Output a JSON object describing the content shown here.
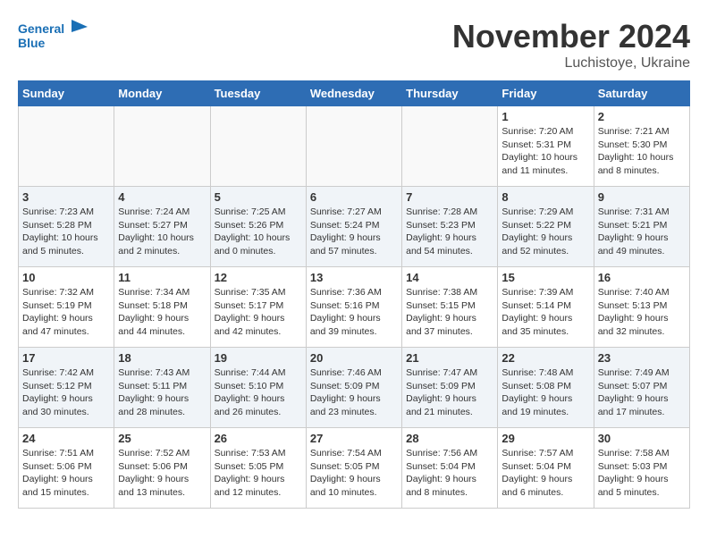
{
  "header": {
    "logo": {
      "line1": "General",
      "line2": "Blue"
    },
    "month": "November 2024",
    "location": "Luchistoye, Ukraine"
  },
  "weekdays": [
    "Sunday",
    "Monday",
    "Tuesday",
    "Wednesday",
    "Thursday",
    "Friday",
    "Saturday"
  ],
  "weeks": [
    [
      {
        "day": "",
        "info": ""
      },
      {
        "day": "",
        "info": ""
      },
      {
        "day": "",
        "info": ""
      },
      {
        "day": "",
        "info": ""
      },
      {
        "day": "",
        "info": ""
      },
      {
        "day": "1",
        "info": "Sunrise: 7:20 AM\nSunset: 5:31 PM\nDaylight: 10 hours and 11 minutes."
      },
      {
        "day": "2",
        "info": "Sunrise: 7:21 AM\nSunset: 5:30 PM\nDaylight: 10 hours and 8 minutes."
      }
    ],
    [
      {
        "day": "3",
        "info": "Sunrise: 7:23 AM\nSunset: 5:28 PM\nDaylight: 10 hours and 5 minutes."
      },
      {
        "day": "4",
        "info": "Sunrise: 7:24 AM\nSunset: 5:27 PM\nDaylight: 10 hours and 2 minutes."
      },
      {
        "day": "5",
        "info": "Sunrise: 7:25 AM\nSunset: 5:26 PM\nDaylight: 10 hours and 0 minutes."
      },
      {
        "day": "6",
        "info": "Sunrise: 7:27 AM\nSunset: 5:24 PM\nDaylight: 9 hours and 57 minutes."
      },
      {
        "day": "7",
        "info": "Sunrise: 7:28 AM\nSunset: 5:23 PM\nDaylight: 9 hours and 54 minutes."
      },
      {
        "day": "8",
        "info": "Sunrise: 7:29 AM\nSunset: 5:22 PM\nDaylight: 9 hours and 52 minutes."
      },
      {
        "day": "9",
        "info": "Sunrise: 7:31 AM\nSunset: 5:21 PM\nDaylight: 9 hours and 49 minutes."
      }
    ],
    [
      {
        "day": "10",
        "info": "Sunrise: 7:32 AM\nSunset: 5:19 PM\nDaylight: 9 hours and 47 minutes."
      },
      {
        "day": "11",
        "info": "Sunrise: 7:34 AM\nSunset: 5:18 PM\nDaylight: 9 hours and 44 minutes."
      },
      {
        "day": "12",
        "info": "Sunrise: 7:35 AM\nSunset: 5:17 PM\nDaylight: 9 hours and 42 minutes."
      },
      {
        "day": "13",
        "info": "Sunrise: 7:36 AM\nSunset: 5:16 PM\nDaylight: 9 hours and 39 minutes."
      },
      {
        "day": "14",
        "info": "Sunrise: 7:38 AM\nSunset: 5:15 PM\nDaylight: 9 hours and 37 minutes."
      },
      {
        "day": "15",
        "info": "Sunrise: 7:39 AM\nSunset: 5:14 PM\nDaylight: 9 hours and 35 minutes."
      },
      {
        "day": "16",
        "info": "Sunrise: 7:40 AM\nSunset: 5:13 PM\nDaylight: 9 hours and 32 minutes."
      }
    ],
    [
      {
        "day": "17",
        "info": "Sunrise: 7:42 AM\nSunset: 5:12 PM\nDaylight: 9 hours and 30 minutes."
      },
      {
        "day": "18",
        "info": "Sunrise: 7:43 AM\nSunset: 5:11 PM\nDaylight: 9 hours and 28 minutes."
      },
      {
        "day": "19",
        "info": "Sunrise: 7:44 AM\nSunset: 5:10 PM\nDaylight: 9 hours and 26 minutes."
      },
      {
        "day": "20",
        "info": "Sunrise: 7:46 AM\nSunset: 5:09 PM\nDaylight: 9 hours and 23 minutes."
      },
      {
        "day": "21",
        "info": "Sunrise: 7:47 AM\nSunset: 5:09 PM\nDaylight: 9 hours and 21 minutes."
      },
      {
        "day": "22",
        "info": "Sunrise: 7:48 AM\nSunset: 5:08 PM\nDaylight: 9 hours and 19 minutes."
      },
      {
        "day": "23",
        "info": "Sunrise: 7:49 AM\nSunset: 5:07 PM\nDaylight: 9 hours and 17 minutes."
      }
    ],
    [
      {
        "day": "24",
        "info": "Sunrise: 7:51 AM\nSunset: 5:06 PM\nDaylight: 9 hours and 15 minutes."
      },
      {
        "day": "25",
        "info": "Sunrise: 7:52 AM\nSunset: 5:06 PM\nDaylight: 9 hours and 13 minutes."
      },
      {
        "day": "26",
        "info": "Sunrise: 7:53 AM\nSunset: 5:05 PM\nDaylight: 9 hours and 12 minutes."
      },
      {
        "day": "27",
        "info": "Sunrise: 7:54 AM\nSunset: 5:05 PM\nDaylight: 9 hours and 10 minutes."
      },
      {
        "day": "28",
        "info": "Sunrise: 7:56 AM\nSunset: 5:04 PM\nDaylight: 9 hours and 8 minutes."
      },
      {
        "day": "29",
        "info": "Sunrise: 7:57 AM\nSunset: 5:04 PM\nDaylight: 9 hours and 6 minutes."
      },
      {
        "day": "30",
        "info": "Sunrise: 7:58 AM\nSunset: 5:03 PM\nDaylight: 9 hours and 5 minutes."
      }
    ]
  ]
}
